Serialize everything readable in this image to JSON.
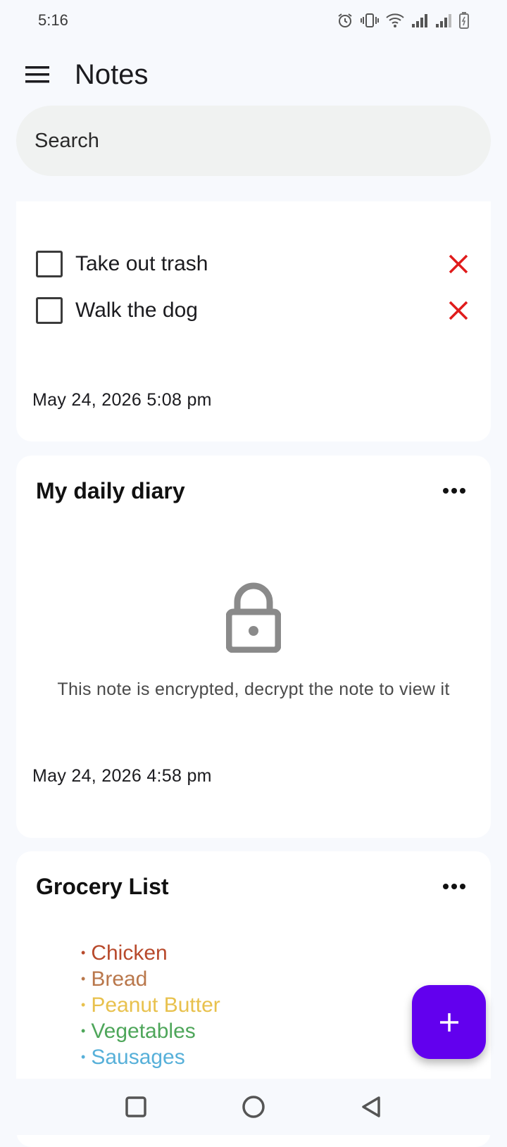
{
  "status": {
    "time": "5:16"
  },
  "app": {
    "title": "Notes"
  },
  "search": {
    "placeholder": "Search"
  },
  "notes": [
    {
      "todos": [
        {
          "text": "Take out trash",
          "checked": false
        },
        {
          "text": "Walk the dog",
          "checked": false
        }
      ],
      "timestamp": "May 24, 2026 5:08 pm"
    },
    {
      "title": "My daily diary",
      "encrypted_message": "This note is encrypted, decrypt the note to view it",
      "timestamp": "May 24, 2026 4:58 pm"
    },
    {
      "title": "Grocery List",
      "items": [
        {
          "text": "Chicken",
          "color": "#b84a2c"
        },
        {
          "text": "Bread",
          "color": "#b9774b"
        },
        {
          "text": "Peanut Butter",
          "color": "#e8c14d"
        },
        {
          "text": "Vegetables",
          "color": "#4ea65a"
        },
        {
          "text": "Sausages",
          "color": "#57b0d9"
        }
      ]
    }
  ],
  "colors": {
    "fab": "#6200ee",
    "remove": "#e01b1b",
    "accent_bg": "#f7f9fd"
  }
}
